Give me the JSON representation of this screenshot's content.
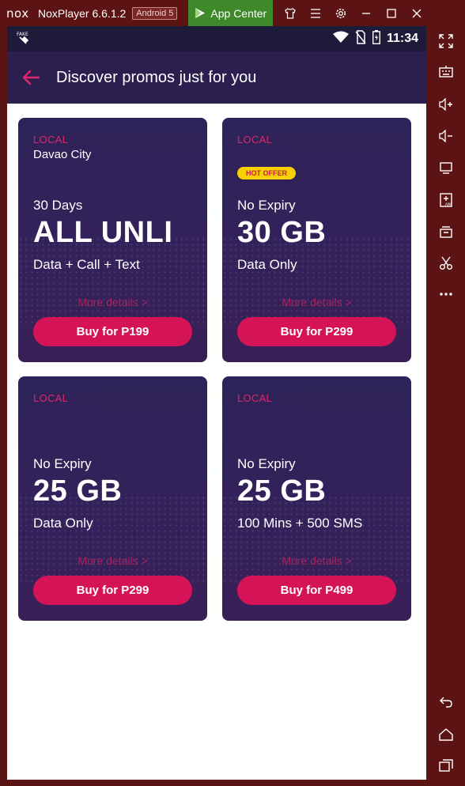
{
  "window": {
    "logo": "nox",
    "app_name": "NoxPlayer 6.6.1.2",
    "android_version": "Android 5",
    "app_center": "App Center",
    "toolbar_icons": [
      "shirt-icon",
      "menu-icon",
      "gear-icon",
      "minimize-icon",
      "maximize-icon",
      "close-icon"
    ]
  },
  "status_bar": {
    "time": "11:34",
    "icons": [
      "satellite-icon",
      "wifi-icon",
      "no-sim-icon",
      "battery-icon"
    ]
  },
  "app_bar": {
    "title": "Discover promos just for you",
    "accent": "#e0266a"
  },
  "promos": [
    {
      "tag": "LOCAL",
      "location": "Davao City",
      "hot_offer": "",
      "duration": "30 Days",
      "headline": "ALL UNLI",
      "subtitle": "Data + Call + Text",
      "more_details": "More details >",
      "buy_label": "Buy for P199"
    },
    {
      "tag": "LOCAL",
      "location": "",
      "hot_offer": "HOT OFFER",
      "duration": "No Expiry",
      "headline": "30 GB",
      "subtitle": "Data Only",
      "more_details": "More details >",
      "buy_label": "Buy for P299"
    },
    {
      "tag": "LOCAL",
      "location": "",
      "hot_offer": "",
      "duration": "No Expiry",
      "headline": "25 GB",
      "subtitle": "Data Only",
      "more_details": "More details >",
      "buy_label": "Buy for P299"
    },
    {
      "tag": "LOCAL",
      "location": "",
      "hot_offer": "",
      "duration": "No Expiry",
      "headline": "25 GB",
      "subtitle": "100 Mins + 500 SMS",
      "more_details": "More details >",
      "buy_label": "Buy for P499"
    }
  ],
  "side_toolbar": {
    "icons": [
      "fullscreen-icon",
      "keyboard-icon",
      "volume-up-icon",
      "volume-down-icon",
      "screen-icon",
      "apk-install-icon",
      "multi-instance-icon",
      "scissors-icon",
      "more-icon",
      "back-nav-icon",
      "home-nav-icon",
      "recent-apps-icon"
    ]
  },
  "colors": {
    "window_frame": "#5c1313",
    "app_center": "#3e8a2a",
    "card_bg": "#2e2358",
    "buy_button": "#d41457",
    "hot_offer_bg": "#f7d000"
  }
}
